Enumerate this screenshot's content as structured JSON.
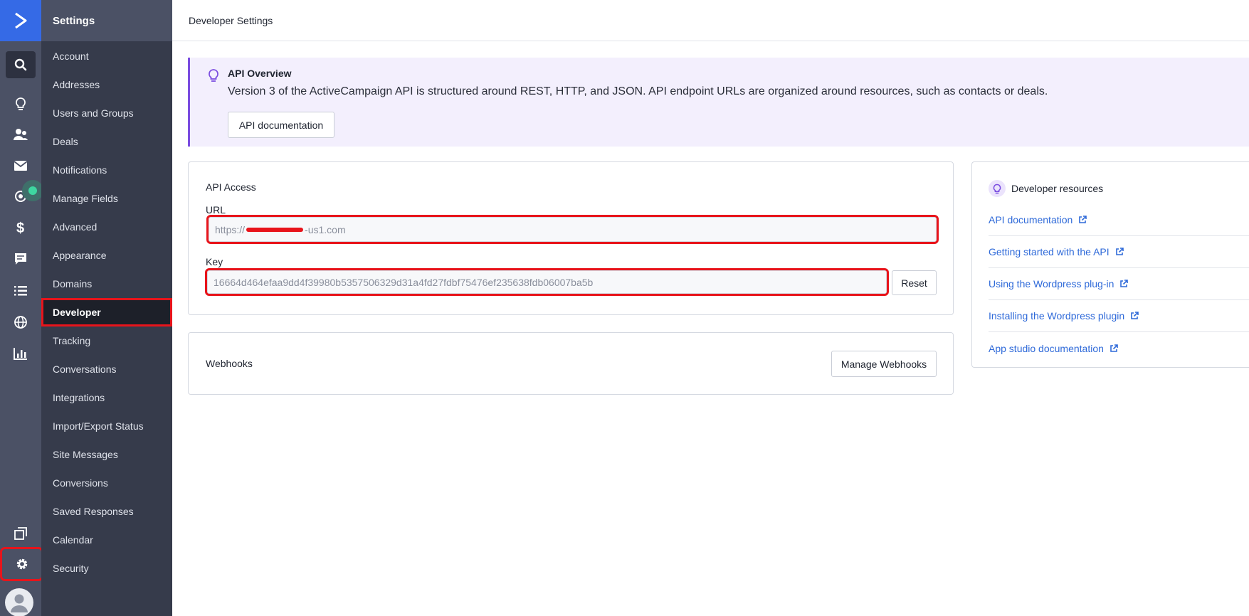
{
  "rail": {
    "logo_icon": "activecampaign-chevron-logo",
    "icons": [
      "search-icon",
      "lightbulb-icon",
      "contacts-icon",
      "email-icon",
      "automations-icon",
      "deals-dollar-icon",
      "conversations-icon",
      "lists-icon",
      "website-globe-icon",
      "reports-chart-icon",
      "pages-icon",
      "gear-icon",
      "avatar-icon"
    ],
    "status_color": "#3ed6a0"
  },
  "menu": {
    "title": "Settings",
    "items": [
      "Account",
      "Addresses",
      "Users and Groups",
      "Deals",
      "Notifications",
      "Manage Fields",
      "Advanced",
      "Appearance",
      "Domains",
      "Developer",
      "Tracking",
      "Conversations",
      "Integrations",
      "Import/Export Status",
      "Site Messages",
      "Conversions",
      "Saved Responses",
      "Calendar",
      "Security"
    ],
    "active_item": "Developer"
  },
  "page": {
    "title": "Developer Settings"
  },
  "banner": {
    "title": "API Overview",
    "text": "Version 3 of the ActiveCampaign API is structured around REST, HTTP, and JSON. API endpoint URLs are organized around resources, such as contacts or deals.",
    "button": "API documentation"
  },
  "api_access": {
    "title": "API Access",
    "url_label": "URL",
    "url_prefix": "https://",
    "url_suffix": "-us1.com",
    "key_label": "Key",
    "key_value": "16664d464efaa9dd4f39980b5357506329d31a4fd27fdbf75476ef235638fdb06007ba5b",
    "reset_button": "Reset"
  },
  "webhooks": {
    "title": "Webhooks",
    "button": "Manage Webhooks"
  },
  "resources": {
    "title": "Developer resources",
    "links": [
      "API documentation",
      "Getting started with the API",
      "Using the Wordpress plug-in",
      "Installing the Wordpress plugin",
      "App studio documentation"
    ]
  },
  "colors": {
    "brand_blue": "#356ae6",
    "highlight_red": "#e8141b",
    "link_blue": "#2f6ad9",
    "banner_purple": "#7a4ce0"
  }
}
